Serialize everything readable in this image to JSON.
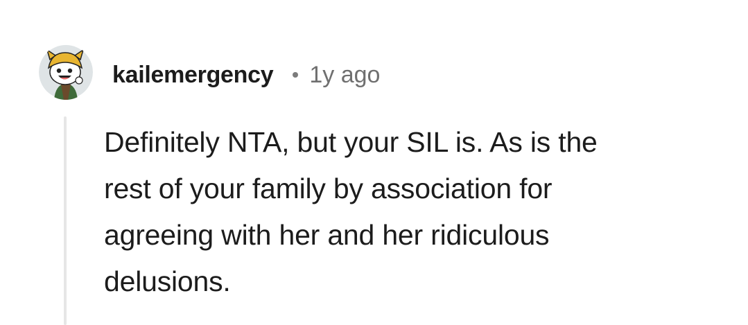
{
  "comment": {
    "author": "kailemergency",
    "timestamp": "1y ago",
    "avatar_icon": "snoo-avatar-icon",
    "body_lines": [
      "Definitely NTA, but your SIL is. As is the",
      "rest of your family by association for",
      "agreeing with her and her ridiculous",
      "delusions."
    ]
  },
  "colors": {
    "thread_line": "#e6e6e6",
    "author": "#1c1c1c",
    "timestamp": "#6f6f6f",
    "avatar_bg": "#dfe4e6"
  }
}
